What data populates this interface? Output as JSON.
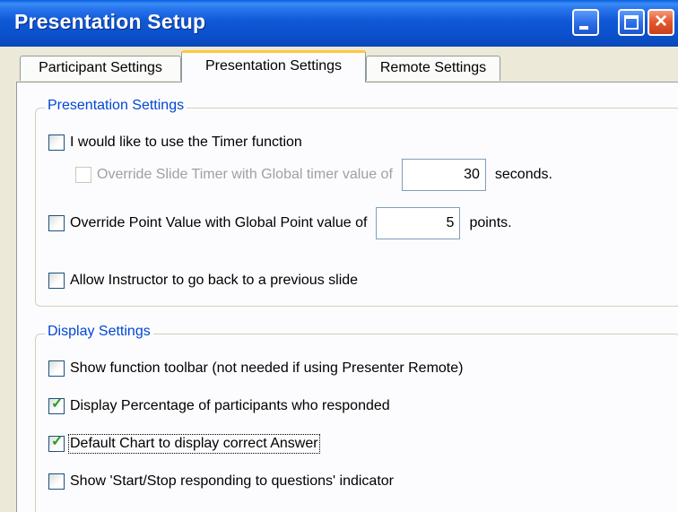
{
  "window": {
    "title": "Presentation Setup"
  },
  "tabs": [
    {
      "label": "Participant Settings"
    },
    {
      "label": "Presentation Settings",
      "active": true
    },
    {
      "label": "Remote Settings"
    }
  ],
  "presentation_settings": {
    "legend": "Presentation Settings",
    "timer": {
      "label": "I would like to use the Timer function",
      "checked": false
    },
    "override_slide_timer": {
      "label": "Override Slide Timer with Global timer value of",
      "value": "30",
      "unit": "seconds.",
      "checked": false,
      "enabled": false
    },
    "override_point_value": {
      "label": "Override Point Value with Global Point value of",
      "value": "5",
      "unit": "points.",
      "checked": false
    },
    "allow_back": {
      "label": "Allow Instructor to go back to a previous slide",
      "checked": false
    }
  },
  "display_settings": {
    "legend": "Display Settings",
    "show_toolbar": {
      "label": "Show function toolbar (not needed if using Presenter Remote)",
      "checked": false
    },
    "display_percentage": {
      "label": "Display Percentage of participants who responded",
      "checked": true
    },
    "default_chart": {
      "label": "Default Chart to display correct Answer",
      "checked": true
    },
    "show_indicator": {
      "label": "Show 'Start/Stop responding to questions' indicator",
      "checked": false
    }
  }
}
